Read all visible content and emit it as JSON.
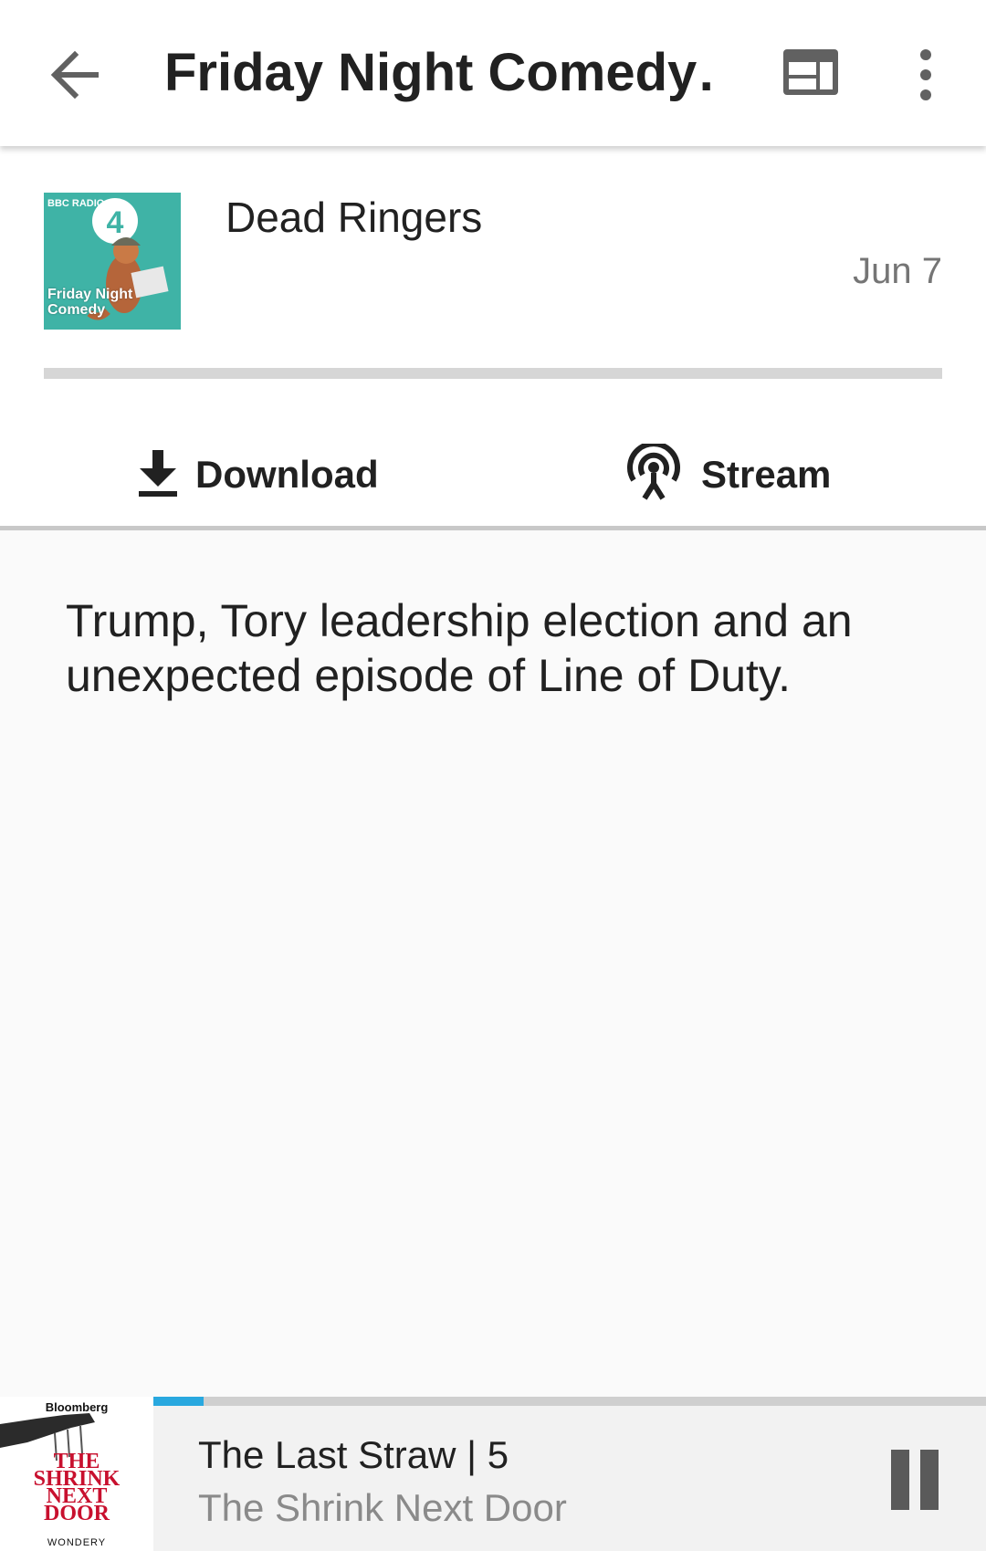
{
  "appbar": {
    "title": "Friday Night Comedy…",
    "back_icon": "arrow-left-icon",
    "web_icon": "web-view-icon",
    "more_icon": "more-vertical-icon"
  },
  "episode": {
    "artwork": {
      "brand": "BBC RADIO",
      "station": "4",
      "show": "Friday Night Comedy",
      "color": "#3fb3a6"
    },
    "title": "Dead Ringers",
    "date": "Jun 7",
    "progress_fraction": 0
  },
  "actions": {
    "download_label": "Download",
    "download_icon": "download-icon",
    "stream_label": "Stream",
    "stream_icon": "podcast-stream-icon"
  },
  "description": "Trump, Tory leadership election and an unexpected episode of Line of Duty.",
  "mini_player": {
    "artwork": {
      "brand": "Bloomberg",
      "show": "THE SHRINK NEXT DOOR",
      "network": "WONDERY"
    },
    "title": "The Last Straw | 5",
    "subtitle": "The Shrink Next Door",
    "progress_fraction": 0.06,
    "accent_color": "#29a8df",
    "pause_icon": "pause-icon"
  }
}
